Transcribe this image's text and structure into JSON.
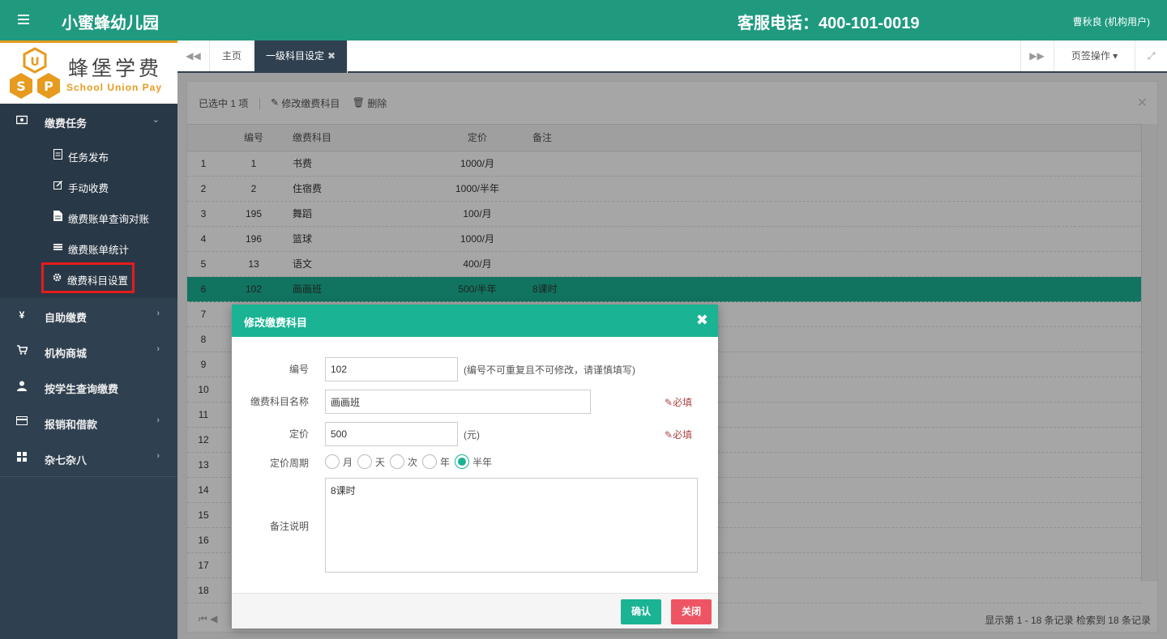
{
  "header": {
    "app_title": "小蜜蜂幼儿园",
    "hotline": "客服电话：400-101-0019",
    "user": "曹秋良 (机构用户)"
  },
  "logo": {
    "text": "蜂堡学费",
    "sub": "School Union Pay"
  },
  "sidebar": {
    "groups": [
      {
        "label": "缴费任务",
        "icon": "money-icon",
        "open": true
      },
      {
        "label": "自助缴费",
        "icon": "yen-icon"
      },
      {
        "label": "机构商城",
        "icon": "cart-icon"
      },
      {
        "label": "按学生查询缴费",
        "icon": "user-icon"
      },
      {
        "label": "报销和借款",
        "icon": "card-icon"
      },
      {
        "label": "杂七杂八",
        "icon": "grid-icon"
      }
    ],
    "sub_items": [
      {
        "label": "任务发布",
        "icon": "file-icon"
      },
      {
        "label": "手动收费",
        "icon": "edit-icon"
      },
      {
        "label": "缴费账单查询对账",
        "icon": "doc-icon"
      },
      {
        "label": "缴费账单统计",
        "icon": "list-icon"
      },
      {
        "label": "缴费科目设置",
        "icon": "gear-icon",
        "active": true
      }
    ]
  },
  "tabs": {
    "home": "主页",
    "active": "一级科目设定",
    "ops": "页签操作"
  },
  "toolbar": {
    "selected": "已选中 1 项",
    "edit": "修改缴费科目",
    "delete": "删除"
  },
  "table": {
    "headers": {
      "code": "编号",
      "name": "缴费科目",
      "price": "定价",
      "note": "备注"
    },
    "rows": [
      {
        "idx": "1",
        "code": "1",
        "name": "书费",
        "price": "1000/月",
        "note": ""
      },
      {
        "idx": "2",
        "code": "2",
        "name": "住宿费",
        "price": "1000/半年",
        "note": ""
      },
      {
        "idx": "3",
        "code": "195",
        "name": "舞蹈",
        "price": "100/月",
        "note": ""
      },
      {
        "idx": "4",
        "code": "196",
        "name": "篮球",
        "price": "1000/月",
        "note": ""
      },
      {
        "idx": "5",
        "code": "13",
        "name": "语文",
        "price": "400/月",
        "note": ""
      },
      {
        "idx": "6",
        "code": "102",
        "name": "画画班",
        "price": "500/半年",
        "note": "8课时",
        "selected": true
      },
      {
        "idx": "7"
      },
      {
        "idx": "8"
      },
      {
        "idx": "9"
      },
      {
        "idx": "10"
      },
      {
        "idx": "11"
      },
      {
        "idx": "12"
      },
      {
        "idx": "13"
      },
      {
        "idx": "14"
      },
      {
        "idx": "15"
      },
      {
        "idx": "16"
      },
      {
        "idx": "17"
      },
      {
        "idx": "18"
      }
    ]
  },
  "pager": {
    "info": "显示第 1 - 18 条记录   检索到 18 条记录"
  },
  "modal": {
    "title": "修改缴费科目",
    "code_label": "编号",
    "code_value": "102",
    "code_hint": "(编号不可重复且不可修改，请谨慎填写)",
    "name_label": "缴费科目名称",
    "name_value": "画画班",
    "required": "必填",
    "price_label": "定价",
    "price_value": "500",
    "price_unit": "(元)",
    "period_label": "定价周期",
    "periods": [
      {
        "label": "月",
        "checked": false
      },
      {
        "label": "天",
        "checked": false
      },
      {
        "label": "次",
        "checked": false
      },
      {
        "label": "年",
        "checked": false
      },
      {
        "label": "半年",
        "checked": true
      }
    ],
    "note_label": "备注说明",
    "note_value": "8课时",
    "ok": "确认",
    "close": "关闭"
  }
}
